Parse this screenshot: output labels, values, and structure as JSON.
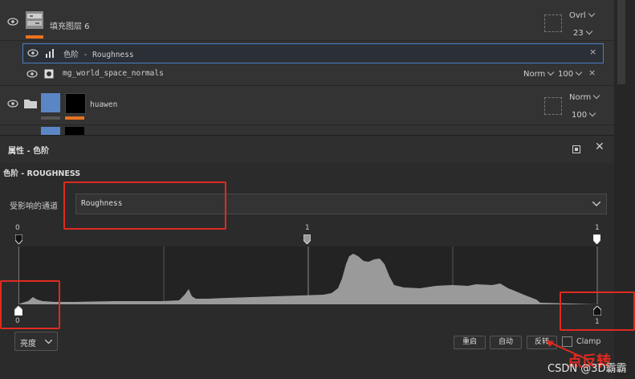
{
  "layers": {
    "rows": [
      {
        "name": "填充图层 6",
        "blend": "Ovrl",
        "opacity": "23"
      },
      {
        "name": "色阶 - Roughness"
      },
      {
        "name": "mg_world_space_normals",
        "blend": "Norm",
        "opacity": "100"
      },
      {
        "name": "huawen",
        "blend": "Norm",
        "opacity": "100"
      }
    ]
  },
  "properties": {
    "panel_title": "属性 - 色阶",
    "section_title": "色阶 - ROUGHNESS",
    "channel_label": "受影响的通道",
    "channel_value": "Roughness",
    "histogram": {
      "top_left": "0",
      "top_mid": "1",
      "top_right": "1",
      "bottom_left": "0",
      "bottom_right": "1"
    },
    "mode_select": "亮度",
    "buttons": {
      "reset": "重启",
      "auto": "自动",
      "invert": "反转"
    },
    "clamp_label": "Clamp"
  },
  "annotation": {
    "text": "点反转",
    "arrow_color": "#e02a20"
  },
  "watermark": "CSDN @3D霸霸",
  "colors": {
    "accent_orange": "#e8731e",
    "highlight_blue": "#4a7fc6",
    "annotation_red": "#e02a20"
  }
}
